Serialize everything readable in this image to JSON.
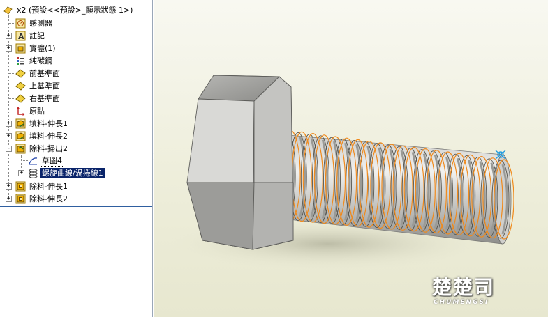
{
  "tree": {
    "root": {
      "label": "x2 (預設<<預設>_顯示狀態 1>)",
      "icon": "part-icon"
    },
    "items": [
      {
        "label": "感測器",
        "icon": "sensor-icon",
        "expander": ""
      },
      {
        "label": "註記",
        "icon": "annotation-icon",
        "expander": "+"
      },
      {
        "label": "實體(1)",
        "icon": "solid-bodies-icon",
        "expander": "+"
      },
      {
        "label": "純碳鋼",
        "icon": "material-icon",
        "expander": ""
      },
      {
        "label": "前基準面",
        "icon": "plane-icon",
        "expander": ""
      },
      {
        "label": "上基準面",
        "icon": "plane-icon",
        "expander": ""
      },
      {
        "label": "右基準面",
        "icon": "plane-icon",
        "expander": ""
      },
      {
        "label": "原點",
        "icon": "origin-icon",
        "expander": ""
      },
      {
        "label": "填料-伸長1",
        "icon": "boss-extrude-icon",
        "expander": "+"
      },
      {
        "label": "填料-伸長2",
        "icon": "boss-extrude-icon",
        "expander": "+"
      },
      {
        "label": "除料-掃出2",
        "icon": "cut-sweep-icon",
        "expander": "-"
      },
      {
        "label": "草圖4",
        "icon": "sketch-icon",
        "expander": ""
      },
      {
        "label": "螺旋曲線/渦捲線1",
        "icon": "helix-icon",
        "expander": "+"
      },
      {
        "label": "除料-伸長1",
        "icon": "cut-extrude-icon",
        "expander": "+"
      },
      {
        "label": "除料-伸長2",
        "icon": "cut-extrude-icon",
        "expander": "+"
      }
    ]
  },
  "watermark": {
    "cn": "楚楚司",
    "en": "CHUMENGSI"
  },
  "colors": {
    "selection": "#0a246a",
    "helix": "#f08a1c",
    "rollback": "#2f5fa0"
  }
}
